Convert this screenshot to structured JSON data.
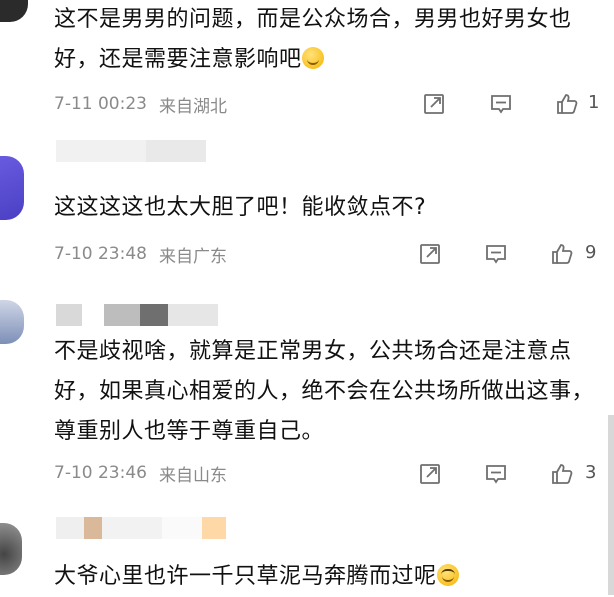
{
  "comments": [
    {
      "text": "这不是男男的问题，而是公众场合，男男也好男女也好，还是需要注意影响吧",
      "emoji": "thinking-emoji",
      "time": "7-11 00:23",
      "location": "来自湖北",
      "likes": "1"
    },
    {
      "text": "这这这这也太大胆了吧！能收敛点不?",
      "time": "7-10 23:48",
      "location": "来自广东",
      "likes": "9"
    },
    {
      "text": "不是歧视啥，就算是正常男女，公共场合还是注意点好，如果真心相爱的人，绝不会在公共场所做出这事，尊重别人也等于尊重自己。",
      "time": "7-10 23:46",
      "location": "来自山东",
      "likes": "3"
    },
    {
      "text": "大爷心里也许一千只草泥马奔腾而过呢",
      "emoji": "laughing-emoji"
    }
  ],
  "icons": {
    "share": "share-icon",
    "comment": "comment-icon",
    "like": "thumbs-up-icon"
  },
  "colors": {
    "text": "#111111",
    "meta": "#8a8a8a",
    "icon": "#6f6f6f",
    "avatar_purple": "#5b4fd6"
  }
}
